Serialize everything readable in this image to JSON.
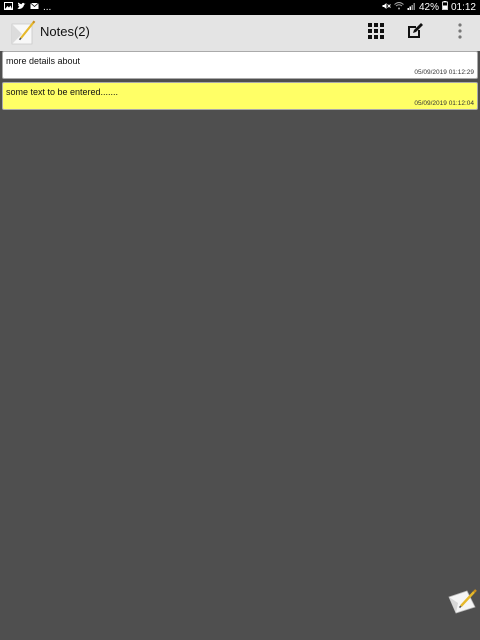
{
  "status_bar": {
    "left_icons": [
      "image-icon",
      "twitter-icon",
      "mail-icon",
      "more-dots-icon"
    ],
    "right_icons": [
      "mute-icon",
      "wifi-icon",
      "signal-icon",
      "battery-icon"
    ],
    "battery_percent": "42%",
    "time": "01:12",
    "more_dots": "..."
  },
  "app_bar": {
    "title": "Notes(2)",
    "actions": [
      {
        "name": "grid-view-icon"
      },
      {
        "name": "edit-note-icon"
      },
      {
        "name": "overflow-menu-icon"
      }
    ]
  },
  "notes": [
    {
      "text": "more details about",
      "timestamp": "05/09/2019 01:12:29",
      "color": "#ffffff"
    },
    {
      "text": "some text to be entered.......",
      "timestamp": "05/09/2019 01:12:04",
      "color": "#ffff66"
    }
  ],
  "fab": {
    "icon": "new-note-icon"
  },
  "colors": {
    "background": "#4f4f4f",
    "app_bar": "#e4e4e4",
    "yellow_note": "#ffff66",
    "status_bar": "#000000"
  }
}
